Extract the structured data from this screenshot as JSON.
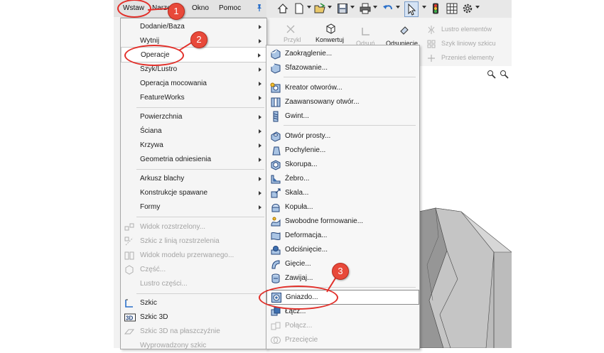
{
  "menubar": {
    "items": [
      "Wstaw",
      "Narzędzia",
      "Okno",
      "Pomoc"
    ],
    "pin_icon": "pin-icon"
  },
  "toolbar": {
    "icons": [
      "home-icon",
      "new-document-icon",
      "open-icon",
      "save-icon",
      "print-icon",
      "undo-icon",
      "select-pointer-icon",
      "traffic-light-icon",
      "grid-icon",
      "gear-icon"
    ]
  },
  "ribbon": {
    "przyklej": "Przykl",
    "konwertuj": "Konwertuj",
    "odsun": "Odsuń",
    "odsuniecie": "Odsunięcie",
    "lustro": "Lustro elementów",
    "szyk": "Szyk liniowy szkicu",
    "przenies": "Przenieś elementy"
  },
  "menu_wstaw": {
    "items": [
      {
        "label": "Dodanie/Baza",
        "submenu": true
      },
      {
        "label": "Wytnij",
        "submenu": true
      },
      {
        "label": "Operacje",
        "submenu": true,
        "selected": true
      },
      {
        "label": "Szyk/Lustro",
        "submenu": true
      },
      {
        "label": "Operacja mocowania",
        "submenu": true
      },
      {
        "label": "FeatureWorks",
        "submenu": true
      },
      {
        "label": "Powierzchnia",
        "submenu": true
      },
      {
        "label": "Ściana",
        "submenu": true
      },
      {
        "label": "Krzywa",
        "submenu": true
      },
      {
        "label": "Geometria odniesienia",
        "submenu": true
      },
      {
        "label": "Arkusz blachy",
        "submenu": true
      },
      {
        "label": "Konstrukcje spawane",
        "submenu": true
      },
      {
        "label": "Formy",
        "submenu": true
      },
      {
        "label": "Widok rozstrzelony...",
        "disabled": true
      },
      {
        "label": "Szkic z linią rozstrzelenia",
        "disabled": true
      },
      {
        "label": "Widok modelu przerwanego...",
        "disabled": true
      },
      {
        "label": "Część...",
        "disabled": true
      },
      {
        "label": "Lustro części...",
        "disabled": true
      },
      {
        "label": "Szkic"
      },
      {
        "label": "Szkic 3D"
      },
      {
        "label": "Szkic 3D na płaszczyźnie",
        "disabled": true
      },
      {
        "label": "Wyprowadzony szkic",
        "disabled": true
      }
    ]
  },
  "menu_operacje": {
    "items": [
      {
        "label": "Zaokrąglenie...",
        "icon": "fillet-icon"
      },
      {
        "label": "Sfazowanie...",
        "icon": "chamfer-icon"
      },
      {
        "label": "Kreator otworów...",
        "icon": "hole-wizard-icon"
      },
      {
        "label": "Zaawansowany otwór...",
        "icon": "advanced-hole-icon"
      },
      {
        "label": "Gwint...",
        "icon": "thread-icon"
      },
      {
        "label": "Otwór prosty...",
        "icon": "simple-hole-icon"
      },
      {
        "label": "Pochylenie...",
        "icon": "draft-icon"
      },
      {
        "label": "Skorupa...",
        "icon": "shell-icon"
      },
      {
        "label": "Żebro...",
        "icon": "rib-icon"
      },
      {
        "label": "Skala...",
        "icon": "scale-icon"
      },
      {
        "label": "Kopuła...",
        "icon": "dome-icon"
      },
      {
        "label": "Swobodne formowanie...",
        "icon": "freeform-icon"
      },
      {
        "label": "Deformacja...",
        "icon": "deform-icon"
      },
      {
        "label": "Odciśnięcie...",
        "icon": "indent-icon"
      },
      {
        "label": "Gięcie...",
        "icon": "flex-icon"
      },
      {
        "label": "Zawijaj...",
        "icon": "wrap-icon"
      },
      {
        "label": "Gniazdo...",
        "icon": "cavity-icon",
        "highlighted": true
      },
      {
        "label": "Łącz...",
        "icon": "combine-icon"
      },
      {
        "label": "Połącz...",
        "icon": "join-icon",
        "disabled": true
      },
      {
        "label": "Przecięcie",
        "icon": "intersect-icon",
        "disabled": true
      }
    ]
  },
  "callouts": [
    "1",
    "2",
    "3"
  ],
  "colors": {
    "callout": "#e8493a",
    "menu_bg": "#f5f5f5",
    "disabled_text": "#a4a4a4",
    "accent_blue": "#2a6fc9"
  }
}
